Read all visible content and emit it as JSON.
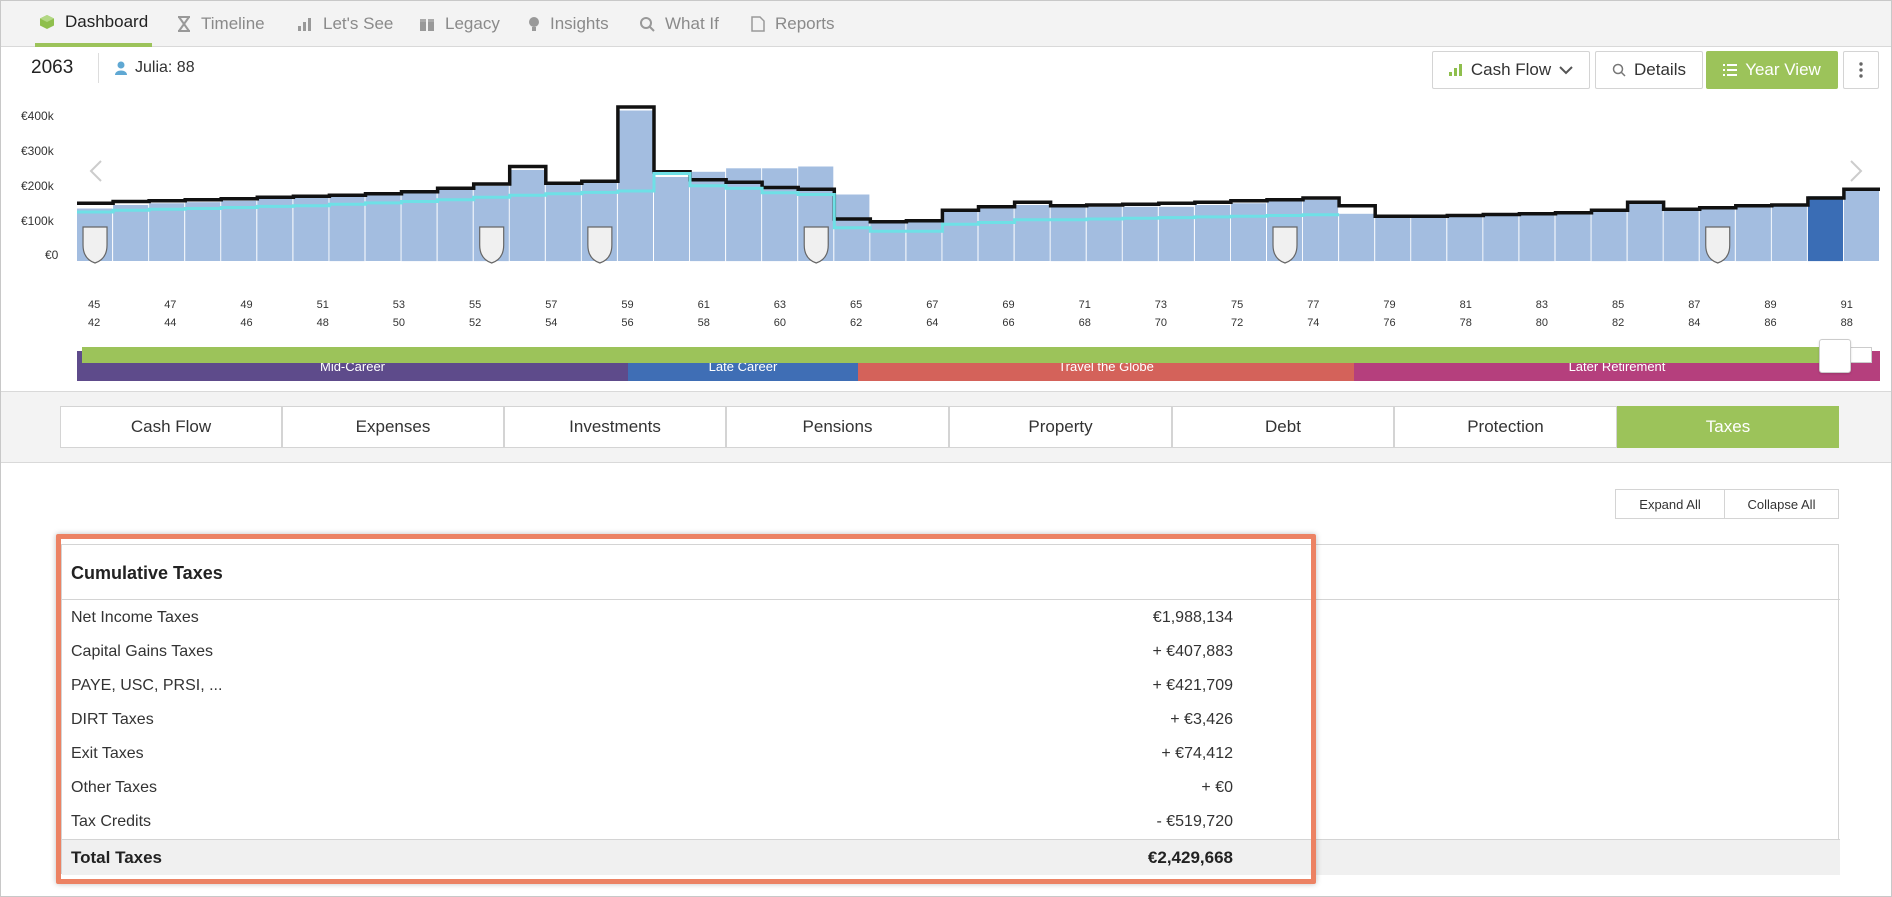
{
  "nav": {
    "tabs": [
      {
        "label": "Dashboard",
        "icon": "cube-icon",
        "active": true
      },
      {
        "label": "Timeline",
        "icon": "hourglass-icon"
      },
      {
        "label": "Let's See",
        "icon": "bar-chart-icon"
      },
      {
        "label": "Legacy",
        "icon": "gift-icon"
      },
      {
        "label": "Insights",
        "icon": "lightbulb-icon"
      },
      {
        "label": "What If",
        "icon": "magnifier-icon"
      },
      {
        "label": "Reports",
        "icon": "pdf-icon"
      }
    ]
  },
  "header": {
    "year": "2063",
    "person": "Julia: 88",
    "view_select": "Cash Flow",
    "details_label": "Details",
    "year_view_label": "Year View"
  },
  "chart_data": {
    "type": "bar",
    "ylabels": [
      "€400k",
      "€300k",
      "€200k",
      "€100k",
      "€0"
    ],
    "ylim": [
      0,
      450000
    ],
    "age_pairs_top": [
      "45",
      "47",
      "49",
      "51",
      "53",
      "55",
      "57",
      "59",
      "61",
      "63",
      "65",
      "67",
      "69",
      "71",
      "73",
      "75",
      "77",
      "79",
      "81",
      "83",
      "85",
      "87",
      "89",
      "91"
    ],
    "age_pairs_bottom": [
      "42",
      "44",
      "46",
      "48",
      "50",
      "52",
      "54",
      "56",
      "58",
      "60",
      "62",
      "64",
      "66",
      "68",
      "70",
      "72",
      "74",
      "76",
      "78",
      "80",
      "82",
      "84",
      "86",
      "88"
    ],
    "bars": [
      150,
      160,
      165,
      168,
      172,
      178,
      180,
      185,
      188,
      195,
      205,
      215,
      260,
      225,
      230,
      430,
      240,
      255,
      265,
      265,
      270,
      190,
      110,
      110,
      140,
      150,
      160,
      155,
      155,
      155,
      155,
      160,
      165,
      170,
      175,
      135,
      130,
      130,
      130,
      135,
      135,
      138,
      145,
      165,
      145,
      150,
      155,
      160,
      185,
      210
    ],
    "outline": [
      165,
      170,
      172,
      175,
      178,
      182,
      185,
      188,
      192,
      198,
      208,
      220,
      270,
      222,
      228,
      440,
      255,
      232,
      225,
      210,
      205,
      120,
      112,
      115,
      145,
      155,
      168,
      158,
      160,
      162,
      165,
      168,
      172,
      175,
      180,
      158,
      128,
      128,
      130,
      133,
      135,
      138,
      145,
      168,
      148,
      152,
      158,
      160,
      180,
      205
    ],
    "cyan": [
      140,
      145,
      148,
      150,
      153,
      156,
      158,
      162,
      166,
      170,
      175,
      182,
      188,
      192,
      196,
      200,
      250,
      215,
      208,
      195,
      190,
      95,
      85,
      85,
      105,
      110,
      118,
      118,
      120,
      122,
      124,
      126,
      128,
      130,
      132,
      null,
      null,
      null,
      null,
      null,
      null,
      null,
      null,
      null,
      null,
      null,
      null,
      null,
      null,
      null
    ],
    "selected_index": 48,
    "phases": [
      {
        "label": "Mid-Career",
        "color": "#5e4b8b"
      },
      {
        "label": "Late Career",
        "color": "#3f6eb5"
      },
      {
        "label": "Travel the Globe",
        "color": "#d4625a"
      },
      {
        "label": "Later Retirement",
        "color": "#b53f7d"
      }
    ]
  },
  "category_tabs": [
    "Cash Flow",
    "Expenses",
    "Investments",
    "Pensions",
    "Property",
    "Debt",
    "Protection",
    "Taxes"
  ],
  "active_category": "Taxes",
  "expand_all": "Expand All",
  "collapse_all": "Collapse All",
  "taxes": {
    "title": "Cumulative Taxes",
    "rows": [
      {
        "label": "Net Income Taxes",
        "value": "€1,988,134"
      },
      {
        "label": "Capital Gains Taxes",
        "value": "+ €407,883"
      },
      {
        "label": "PAYE, USC, PRSI, ...",
        "value": "+ €421,709"
      },
      {
        "label": "DIRT Taxes",
        "value": "+ €3,426"
      },
      {
        "label": "Exit Taxes",
        "value": "+ €74,412"
      },
      {
        "label": "Other Taxes",
        "value": "+ €0"
      },
      {
        "label": "Tax Credits",
        "value": "- €519,720"
      }
    ],
    "total_label": "Total Taxes",
    "total_value": "€2,429,668"
  }
}
